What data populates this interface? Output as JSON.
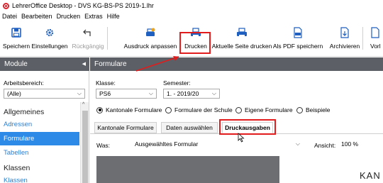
{
  "window": {
    "title": "LehrerOffice Desktop - DVS KG-BS-PS 2019-1.lhr"
  },
  "menu": [
    "Datei",
    "Bearbeiten",
    "Drucken",
    "Extras",
    "Hilfe"
  ],
  "toolbar": {
    "save": "Speichern",
    "settings": "Einstellungen",
    "undo": "Rückgängig",
    "customize": "Ausdruck anpassen",
    "print": "Drucken",
    "print_page": "Aktuelle Seite drucken",
    "save_pdf": "Als PDF speichern",
    "archive": "Archivieren",
    "next_partial": "Vorl"
  },
  "sidebar": {
    "header": "Module",
    "area_label": "Arbeitsbereich:",
    "area_value": "(Alle)",
    "group_general": "Allgemeines",
    "items_general": [
      "Adressen",
      "Formulare",
      "Tabellen"
    ],
    "group_classes": "Klassen",
    "items_classes": [
      "Klassen"
    ]
  },
  "main": {
    "header": "Formulare",
    "class_label": "Klasse:",
    "class_value": "PS6",
    "semester_label": "Semester:",
    "semester_value": "1. - 2019/20",
    "radios": [
      "Kantonale Formulare",
      "Formulare der Schule",
      "Eigene Formulare",
      "Beispiele"
    ],
    "radio_selected": "Kantonale Formulare",
    "tabs": [
      "Kantonale Formulare",
      "Daten auswählen",
      "Druckausgaben"
    ],
    "active_tab": "Druckausgaben",
    "was_label": "Was:",
    "was_value": "Ausgewähltes Formular",
    "view_label": "Ansicht:",
    "view_value": "100 %",
    "preview_text": "KAN"
  },
  "colors": {
    "accent_blue": "#2d8ae6",
    "header_gray": "#5c5f65",
    "highlight_red": "#e21c1c"
  }
}
